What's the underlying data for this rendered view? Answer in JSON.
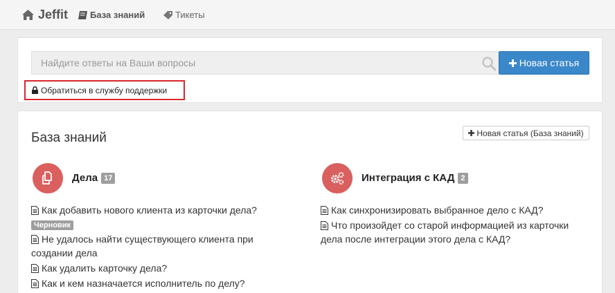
{
  "nav": {
    "brand": "Jeffit",
    "items": [
      {
        "label": "База знаний",
        "icon": "book-icon",
        "active": true
      },
      {
        "label": "Тикеты",
        "icon": "tag-icon",
        "active": false
      }
    ]
  },
  "search": {
    "placeholder": "Найдите ответы на Ваши вопросы",
    "new_article_label": "Новая статья",
    "support_link": "Обратиться в службу поддержки"
  },
  "kb": {
    "title": "База знаний",
    "new_article_label": "Новая статья (База знаний)",
    "categories": [
      {
        "title": "Дела",
        "count": "17",
        "icon": "files-icon",
        "articles": [
          {
            "title": "Как добавить нового клиента из карточки дела?",
            "badge": "Черновик"
          },
          {
            "title_line1": "Не удалось найти существующего клиента при",
            "title_line2": "создании дела"
          },
          {
            "title": "Как удалить карточку дела?"
          },
          {
            "title": "Как и кем назначается исполнитель по делу?"
          }
        ]
      },
      {
        "title": "Интеграция с КАД",
        "count": "2",
        "icon": "gears-icon",
        "articles": [
          {
            "title": "Как синхронизировать выбранное дело с КАД?"
          },
          {
            "title_line1": "Что произойдет со старой информацией из карточки",
            "title_line2": "дела после интеграции этого дела с КАД?"
          }
        ]
      }
    ]
  },
  "colors": {
    "primary": "#3a87c9",
    "category_circle": "#d9605e",
    "highlight_border": "#d9262c",
    "badge": "#9e9e9e"
  }
}
